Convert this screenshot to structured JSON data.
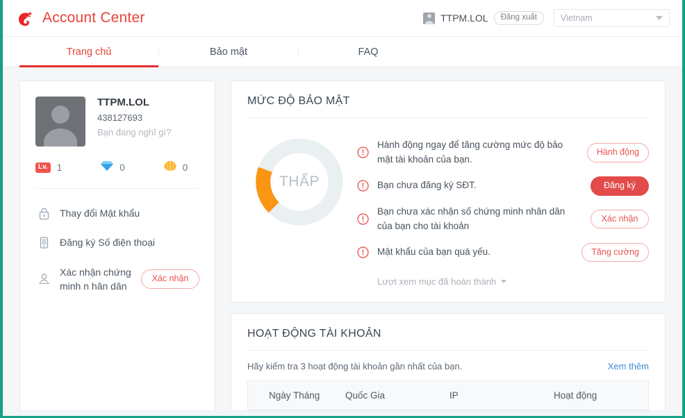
{
  "header": {
    "brand_title": "Account Center",
    "logo_icon": "garena-logo-icon",
    "user_name": "TTPM.LOL",
    "logout_label": "Đăng xuất",
    "country_value": "Vietnam"
  },
  "tabs": [
    {
      "label": "Trang chủ",
      "active": true
    },
    {
      "label": "Bảo mật",
      "active": false
    },
    {
      "label": "FAQ",
      "active": false
    }
  ],
  "profile": {
    "name": "TTPM.LOL",
    "id": "438127693",
    "status": "Bạn đang nghĩ gì?",
    "stats": [
      {
        "icon": "level-badge-icon",
        "badge": "Lv.",
        "value": "1"
      },
      {
        "icon": "diamond-icon",
        "value": "0"
      },
      {
        "icon": "shell-icon",
        "value": "0"
      }
    ],
    "menu": [
      {
        "icon": "lock-icon",
        "label": "Thay đổi Mật khẩu",
        "action": null
      },
      {
        "icon": "phone-icon",
        "label": "Đăng ký Số điện thoại",
        "action": null
      },
      {
        "icon": "id-card-icon",
        "label": "Xác nhận chứng minh n hân dân",
        "action": "Xác nhận"
      }
    ]
  },
  "security": {
    "title": "MỨC ĐỘ BẢO MẬT",
    "gauge_label": "THẤP",
    "gauge_percent": 28,
    "gauge_color": "#fa9614",
    "gauge_track_color": "#eaeff2",
    "alerts": [
      {
        "icon": "alert-circle-icon",
        "text": "Hành động ngay để tăng cường mức độ bảo mật tài khoản của bạn.",
        "button": "Hành động",
        "style": "outline"
      },
      {
        "icon": "alert-circle-icon",
        "text": "Bạn chưa đăng ký SĐT.",
        "button": "Đăng ký",
        "style": "solid"
      },
      {
        "icon": "alert-circle-icon",
        "text": "Bạn chưa xác nhận số chứng minh nhân dân của bạn cho tài khoản",
        "button": "Xác nhận",
        "style": "outline"
      },
      {
        "icon": "alert-circle-icon",
        "text": "Mật khẩu của bạn quá yếu.",
        "button": "Tăng cường",
        "style": "outline"
      }
    ],
    "more_label": "Lượt xem mục đã hoàn thành"
  },
  "activity": {
    "title": "HOẠT ĐỘNG TÀI KHOẢN",
    "subtitle": "Hãy kiểm tra 3 hoạt động tài khoản gần nhất của bạn.",
    "more_label": "Xem thêm",
    "columns": [
      "Ngày Tháng",
      "Quốc Gia",
      "IP",
      "Hoạt động"
    ],
    "rows": []
  },
  "colors": {
    "brand_red": "#e8433a",
    "accent_red": "#e34b4b",
    "orange": "#fa9614",
    "link_blue": "#3b8fd6",
    "edge_teal": "#16a085"
  }
}
